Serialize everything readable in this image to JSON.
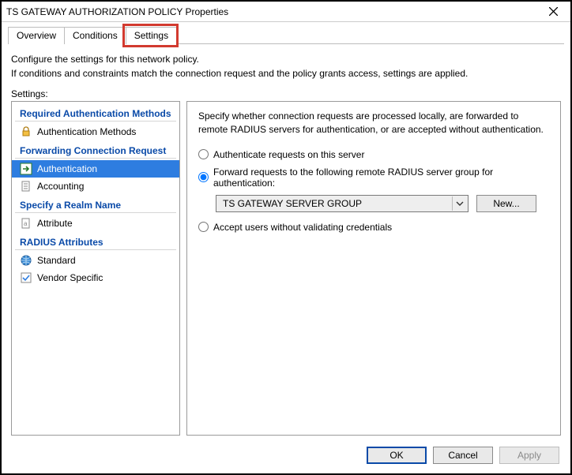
{
  "window": {
    "title": "TS GATEWAY AUTHORIZATION POLICY Properties"
  },
  "tabs": {
    "overview": "Overview",
    "conditions": "Conditions",
    "settings": "Settings"
  },
  "description": {
    "line1": "Configure the settings for this network policy.",
    "line2": "If conditions and constraints match the connection request and the policy grants access, settings are applied."
  },
  "settings_label": "Settings:",
  "left": {
    "group_required_auth": "Required Authentication Methods",
    "item_auth_methods": "Authentication Methods",
    "group_forwarding": "Forwarding Connection Request",
    "item_authentication": "Authentication",
    "item_accounting": "Accounting",
    "group_realm": "Specify a Realm Name",
    "item_attribute": "Attribute",
    "group_radius_attrs": "RADIUS Attributes",
    "item_standard": "Standard",
    "item_vendor_specific": "Vendor Specific"
  },
  "right": {
    "desc": "Specify whether connection requests are processed locally, are forwarded to remote RADIUS servers for authentication, or are accepted without authentication.",
    "radio_local": "Authenticate requests on this server",
    "radio_forward": "Forward requests to the following remote RADIUS server group for authentication:",
    "combo_value": "TS GATEWAY SERVER GROUP",
    "btn_new": "New...",
    "radio_accept": "Accept users without validating credentials"
  },
  "footer": {
    "ok": "OK",
    "cancel": "Cancel",
    "apply": "Apply"
  }
}
